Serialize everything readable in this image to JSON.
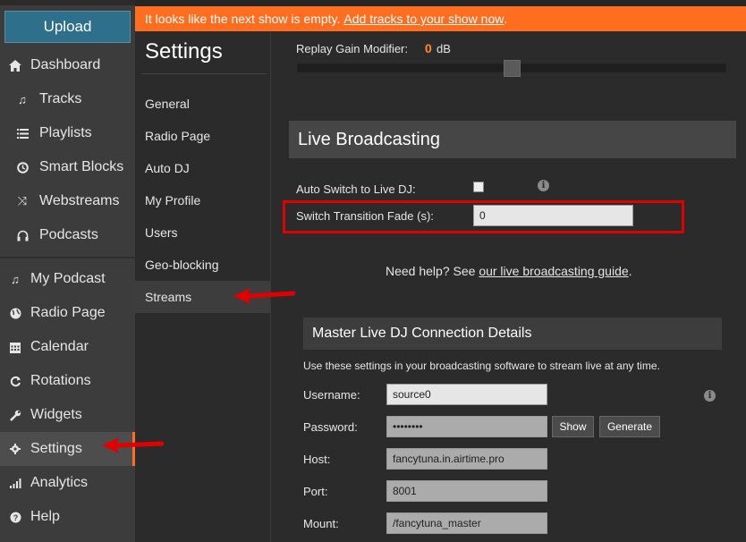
{
  "sidebar": {
    "upload_label": "Upload",
    "items": [
      {
        "label": "Dashboard",
        "icon": "home-icon"
      },
      {
        "label": "Tracks",
        "icon": "music-note-icon"
      },
      {
        "label": "Playlists",
        "icon": "list-icon"
      },
      {
        "label": "Smart Blocks",
        "icon": "clock-icon"
      },
      {
        "label": "Webstreams",
        "icon": "shuffle-icon"
      },
      {
        "label": "Podcasts",
        "icon": "headphones-icon"
      },
      {
        "label": "My Podcast",
        "icon": "music-note-icon"
      },
      {
        "label": "Radio Page",
        "icon": "globe-icon"
      },
      {
        "label": "Calendar",
        "icon": "calendar-icon"
      },
      {
        "label": "Rotations",
        "icon": "refresh-icon"
      },
      {
        "label": "Widgets",
        "icon": "wrench-icon"
      },
      {
        "label": "Settings",
        "icon": "gear-icon"
      },
      {
        "label": "Analytics",
        "icon": "bar-chart-icon"
      },
      {
        "label": "Help",
        "icon": "question-icon"
      }
    ]
  },
  "banner": {
    "text": "It looks like the next show is empty.",
    "link": "Add tracks to your show now",
    "after": "."
  },
  "settings_nav": {
    "title": "Settings",
    "items": [
      "General",
      "Radio Page",
      "Auto DJ",
      "My Profile",
      "Users",
      "Geo-blocking",
      "Streams"
    ]
  },
  "main": {
    "replay_gain_label": "Replay Gain Modifier:",
    "replay_gain_value": "0",
    "replay_gain_unit": "dB",
    "replay_gain_level": 0.5,
    "live_broadcasting_title": "Live Broadcasting",
    "auto_switch_label": "Auto Switch to Live DJ:",
    "auto_switch_checked": false,
    "transition_fade_label": "Switch Transition Fade (s):",
    "transition_fade_value": "0",
    "help_prefix": "Need help? See",
    "help_link": "our live broadcasting guide",
    "help_suffix": ".",
    "master_title": "Master Live DJ Connection Details",
    "master_desc": "Use these settings in your broadcasting software to stream live at any time.",
    "username_label": "Username:",
    "username_value": "source0",
    "password_label": "Password:",
    "password_value": "••••••••",
    "show_label": "Show",
    "generate_label": "Generate",
    "host_label": "Host:",
    "host_value": "fancytuna.in.airtime.pro",
    "port_label": "Port:",
    "port_value": "8001",
    "mount_label": "Mount:",
    "mount_value": "/fancytuna_master"
  },
  "colors": {
    "accent": "#ff6d1f",
    "highlight": "#e00000",
    "upload": "#2e6f8c"
  }
}
